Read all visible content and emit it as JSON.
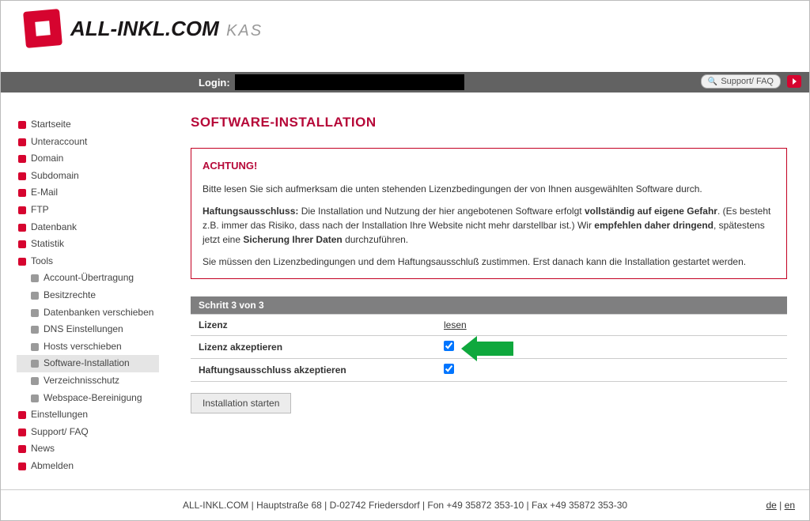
{
  "header": {
    "brand_text": "ALL-INKL.COM",
    "brand_sub": "KAS"
  },
  "login_bar": {
    "label": "Login:",
    "support_link": "Support/ FAQ"
  },
  "sidebar": {
    "items": [
      {
        "label": "Startseite",
        "bullet": "red",
        "sub": false
      },
      {
        "label": "Unteraccount",
        "bullet": "red",
        "sub": false
      },
      {
        "label": "Domain",
        "bullet": "red",
        "sub": false
      },
      {
        "label": "Subdomain",
        "bullet": "red",
        "sub": false
      },
      {
        "label": "E-Mail",
        "bullet": "red",
        "sub": false
      },
      {
        "label": "FTP",
        "bullet": "red",
        "sub": false
      },
      {
        "label": "Datenbank",
        "bullet": "red",
        "sub": false
      },
      {
        "label": "Statistik",
        "bullet": "red",
        "sub": false
      },
      {
        "label": "Tools",
        "bullet": "red",
        "sub": false
      },
      {
        "label": "Account-Übertragung",
        "bullet": "grey",
        "sub": true
      },
      {
        "label": "Besitzrechte",
        "bullet": "grey",
        "sub": true
      },
      {
        "label": "Datenbanken verschieben",
        "bullet": "grey",
        "sub": true
      },
      {
        "label": "DNS Einstellungen",
        "bullet": "grey",
        "sub": true
      },
      {
        "label": "Hosts verschieben",
        "bullet": "grey",
        "sub": true
      },
      {
        "label": "Software-Installation",
        "bullet": "grey",
        "sub": true,
        "active": true
      },
      {
        "label": "Verzeichnisschutz",
        "bullet": "grey",
        "sub": true
      },
      {
        "label": "Webspace-Bereinigung",
        "bullet": "grey",
        "sub": true
      },
      {
        "label": "Einstellungen",
        "bullet": "red",
        "sub": false
      },
      {
        "label": "Support/ FAQ",
        "bullet": "red",
        "sub": false
      },
      {
        "label": "News",
        "bullet": "red",
        "sub": false
      },
      {
        "label": "Abmelden",
        "bullet": "red",
        "sub": false
      }
    ]
  },
  "main": {
    "title": "SOFTWARE-INSTALLATION",
    "warning": {
      "heading": "ACHTUNG!",
      "p1": "Bitte lesen Sie sich aufmerksam die unten stehenden Lizenzbedingungen der von Ihnen ausgewählten Software durch.",
      "p2_prefix": "Haftungsausschluss:",
      "p2_text1": " Die Installation und Nutzung der hier angebotenen Software erfolgt ",
      "p2_bold1": "vollständig auf eigene Gefahr",
      "p2_text2": ". (Es besteht z.B. immer das Risiko, dass nach der Installation Ihre Website nicht mehr darstellbar ist.) Wir ",
      "p2_bold2": "empfehlen daher dringend",
      "p2_text3": ", spätestens jetzt eine ",
      "p2_bold3": "Sicherung Ihrer Daten",
      "p2_text4": " durchzuführen.",
      "p3": "Sie müssen den Lizenzbedingungen und dem Haftungsausschluß zustimmen. Erst danach kann die Installation gestartet werden."
    },
    "step_label": "Schritt 3 von 3",
    "rows": {
      "license_label": "Lizenz",
      "license_link": "lesen",
      "accept_license_label": "Lizenz akzeptieren",
      "accept_disclaimer_label": "Haftungsausschluss akzeptieren"
    },
    "install_button": "Installation starten"
  },
  "footer": {
    "text": "ALL-INKL.COM | Hauptstraße 68 | D-02742 Friedersdorf | Fon +49 35872 353-10 | Fax +49 35872 353-30",
    "lang_de": "de",
    "lang_en": "en"
  }
}
